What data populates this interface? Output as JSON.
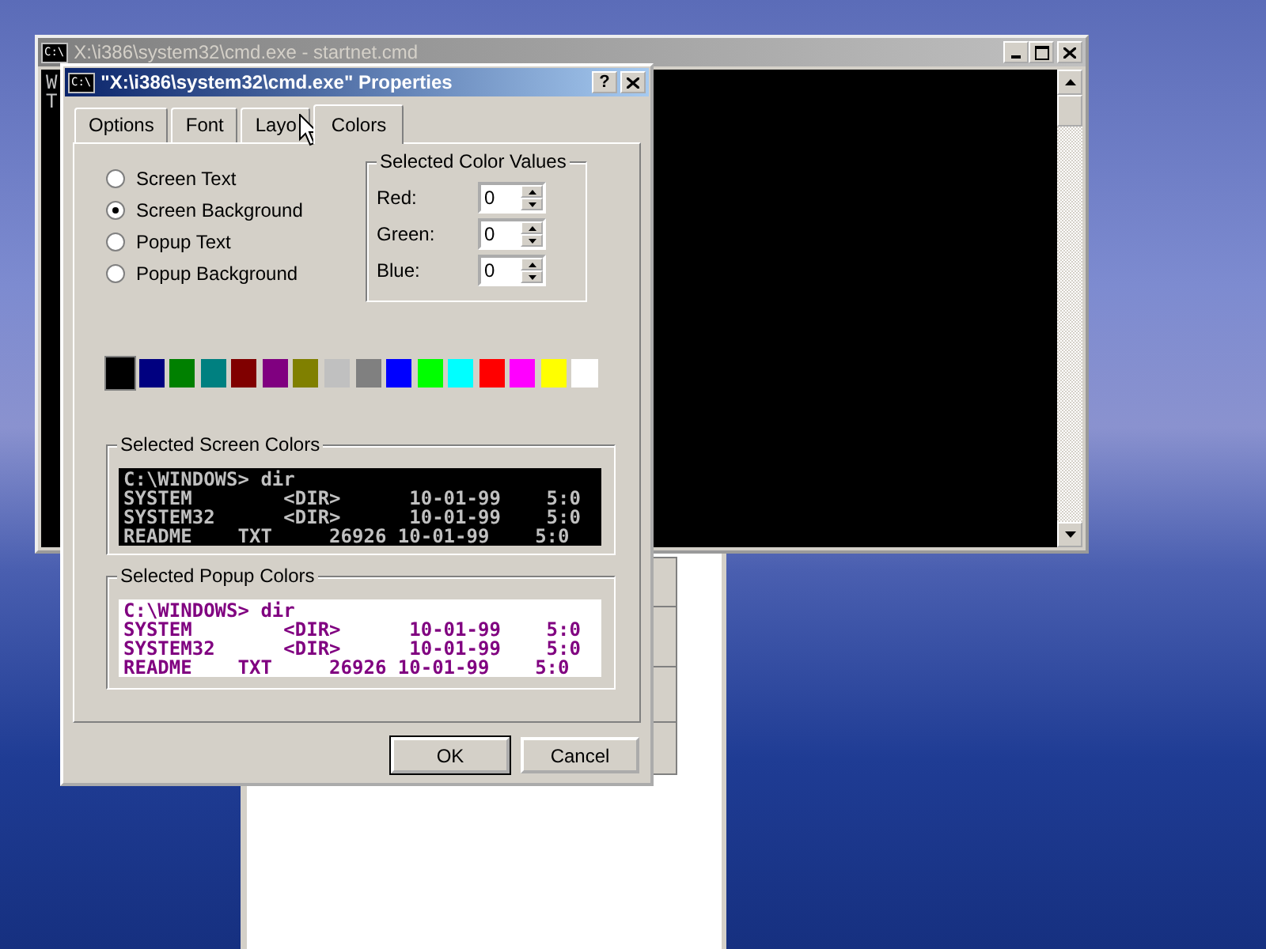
{
  "console_window": {
    "title": "X:\\i386\\system32\\cmd.exe - startnet.cmd",
    "icon_label": "C:\\",
    "active": false,
    "lines": [
      "W",
      "T"
    ]
  },
  "dialog": {
    "title": "\"X:\\i386\\system32\\cmd.exe\" Properties",
    "icon_label": "C:\\",
    "help_button": "?",
    "active": true,
    "tabs": [
      {
        "label": "Options",
        "selected": false
      },
      {
        "label": "Font",
        "selected": false
      },
      {
        "label": "Layo",
        "selected": false
      },
      {
        "label": "Colors",
        "selected": true
      }
    ],
    "radios": [
      {
        "label": "Screen Text",
        "selected": false
      },
      {
        "label": "Screen Background",
        "selected": true
      },
      {
        "label": "Popup Text",
        "selected": false
      },
      {
        "label": "Popup Background",
        "selected": false
      }
    ],
    "color_values": {
      "legend": "Selected Color Values",
      "fields": [
        {
          "label": "Red:",
          "value": "0"
        },
        {
          "label": "Green:",
          "value": "0"
        },
        {
          "label": "Blue:",
          "value": "0"
        }
      ]
    },
    "palette": [
      {
        "color": "#000000",
        "selected": true
      },
      {
        "color": "#000080",
        "selected": false
      },
      {
        "color": "#008000",
        "selected": false
      },
      {
        "color": "#008080",
        "selected": false
      },
      {
        "color": "#800000",
        "selected": false
      },
      {
        "color": "#800080",
        "selected": false
      },
      {
        "color": "#808000",
        "selected": false
      },
      {
        "color": "#c0c0c0",
        "selected": false
      },
      {
        "color": "#808080",
        "selected": false
      },
      {
        "color": "#0000ff",
        "selected": false
      },
      {
        "color": "#00ff00",
        "selected": false
      },
      {
        "color": "#00ffff",
        "selected": false
      },
      {
        "color": "#ff0000",
        "selected": false
      },
      {
        "color": "#ff00ff",
        "selected": false
      },
      {
        "color": "#ffff00",
        "selected": false
      },
      {
        "color": "#ffffff",
        "selected": false
      }
    ],
    "previews": [
      {
        "legend": "Selected Screen Colors",
        "kind": "screen",
        "lines": [
          "C:\\WINDOWS> dir",
          "SYSTEM        <DIR>      10-01-99    5:0",
          "SYSTEM32      <DIR>      10-01-99    5:0",
          "README    TXT     26926 10-01-99    5:0"
        ]
      },
      {
        "legend": "Selected Popup Colors",
        "kind": "popup",
        "lines": [
          "C:\\WINDOWS> dir",
          "SYSTEM        <DIR>      10-01-99    5:0",
          "SYSTEM32      <DIR>      10-01-99    5:0",
          "README    TXT     26926 10-01-99    5:0"
        ]
      }
    ],
    "buttons": [
      {
        "label": "OK",
        "default": true
      },
      {
        "label": "Cancel",
        "default": false
      }
    ]
  }
}
